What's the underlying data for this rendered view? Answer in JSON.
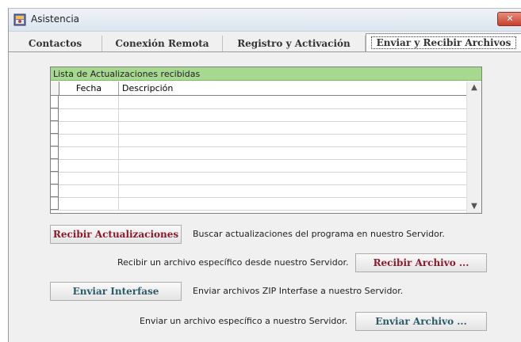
{
  "window": {
    "title": "Asistencia",
    "close_label": "✕"
  },
  "tabs": [
    {
      "label": "Contactos"
    },
    {
      "label": "Conexión Remota"
    },
    {
      "label": "Registro y Activación"
    },
    {
      "label": "Enviar y Recibir Archivos",
      "active": true
    }
  ],
  "grid": {
    "caption": "Lista de Actualizaciones recibidas",
    "columns": [
      "Fecha",
      "Descripción"
    ],
    "rows": []
  },
  "actions": {
    "recibir_actualizaciones": {
      "button": "Recibir Actualizaciones",
      "description": "Buscar actualizaciones del programa en nuestro Servidor."
    },
    "recibir_archivo": {
      "description": "Recibir un archivo específico desde nuestro Servidor.",
      "button": "Recibir Archivo ..."
    },
    "enviar_interfase": {
      "button": "Enviar Interfase",
      "description": "Enviar archivos ZIP Interfase a nuestro Servidor."
    },
    "enviar_archivo": {
      "description": "Enviar un archivo específico a nuestro Servidor.",
      "button": "Enviar Archivo ..."
    }
  },
  "colors": {
    "caption_bg": "#a6d88f",
    "red_button_text": "#8b1a2b",
    "teal_button_text": "#2a5b66"
  }
}
